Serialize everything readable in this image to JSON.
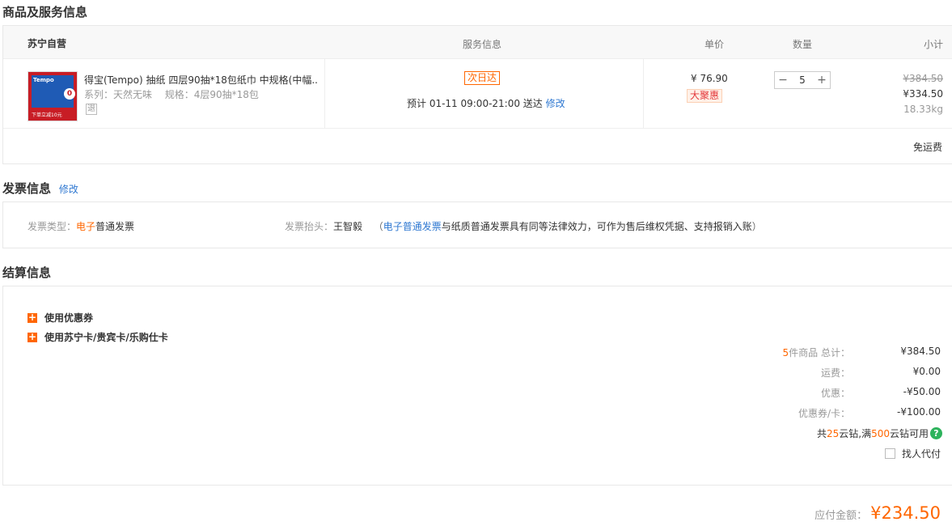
{
  "product_section": {
    "title": "商品及服务信息",
    "store_name": "苏宁自营",
    "columns": {
      "service": "服务信息",
      "unit_price": "单价",
      "quantity": "数量",
      "subtotal": "小计"
    },
    "item": {
      "image_badge": "Tempo",
      "image_caption": "下单立减10元",
      "name": "得宝(Tempo) 抽纸 四层90抽*18包纸巾 中规格(中幅...",
      "series_label": "系列：",
      "series_value": "天然无味",
      "spec_label": "规格：",
      "spec_value": "4层90抽*18包",
      "return_tag": "退",
      "delivery_tag": "次日达",
      "delivery_estimate": "预计 01-11 09:00-21:00 送达",
      "delivery_modify": "修改",
      "unit_price": "¥ 76.90",
      "promo_tag": "大聚惠",
      "quantity": "5",
      "minus": "−",
      "plus": "+",
      "original_subtotal": "¥384.50",
      "subtotal": "¥334.50",
      "weight": "18.33kg"
    },
    "shipping_note": "免运费"
  },
  "invoice_section": {
    "title": "发票信息",
    "modify": "修改",
    "type_label": "发票类型：",
    "type_highlight": "电子",
    "type_rest": "普通发票",
    "header_label": "发票抬头：",
    "header_value": "王智毅",
    "note_open": "（",
    "note_link": "电子普通发票",
    "note_text": "与纸质普通发票具有同等法律效力，可作为售后维权凭据、支持报销入账",
    "note_close": "）"
  },
  "settlement_section": {
    "title": "结算信息",
    "options": [
      {
        "icon": "+",
        "label": "使用优惠券"
      },
      {
        "icon": "+",
        "label": "使用苏宁卡/贵宾卡/乐购仕卡"
      }
    ],
    "summary": {
      "count": "5",
      "count_suffix": "件商品 总计：",
      "total": "¥384.50",
      "shipping_label": "运费：",
      "shipping_value": "¥0.00",
      "discount_label": "优惠：",
      "discount_value": "-¥50.00",
      "coupon_label": "优惠券/卡：",
      "coupon_value": "-¥100.00",
      "yunzuan_prefix": "共 ",
      "yunzuan_count": "25",
      "yunzuan_mid": "云钻,满",
      "yunzuan_threshold": "500",
      "yunzuan_suffix": " 云钻可用",
      "help_icon": "?",
      "proxy_pay_label": "找人代付"
    },
    "payable_label": "应付金额：",
    "payable_value": "¥234.50"
  },
  "colors": {
    "accent_orange": "#ff6600",
    "link_blue": "#2f78d1",
    "promo_red": "#e4393c",
    "help_green": "#2db35c"
  }
}
